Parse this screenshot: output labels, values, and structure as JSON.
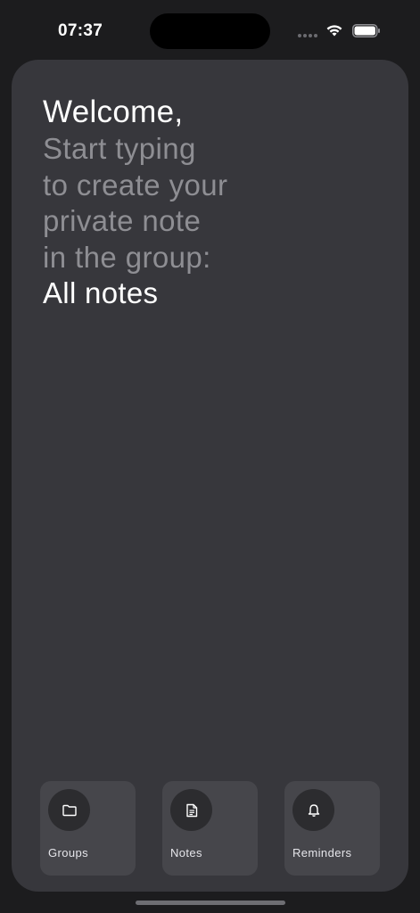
{
  "status_bar": {
    "time": "07:37"
  },
  "welcome": {
    "title": "Welcome,",
    "prompt_lines": [
      "Start typing",
      "to create your",
      "private note",
      "in the group:"
    ],
    "group_name": "All notes"
  },
  "nav": {
    "items": [
      {
        "label": "Groups",
        "icon": "folder-icon"
      },
      {
        "label": "Notes",
        "icon": "document-icon"
      },
      {
        "label": "Reminders",
        "icon": "bell-icon"
      }
    ]
  },
  "colors": {
    "background": "#1c1c1e",
    "card": "#37373c",
    "tile": "#46464b",
    "tile_icon_bg": "#2c2c2f",
    "muted_text": "#8e8e93",
    "primary_text": "#ffffff"
  }
}
